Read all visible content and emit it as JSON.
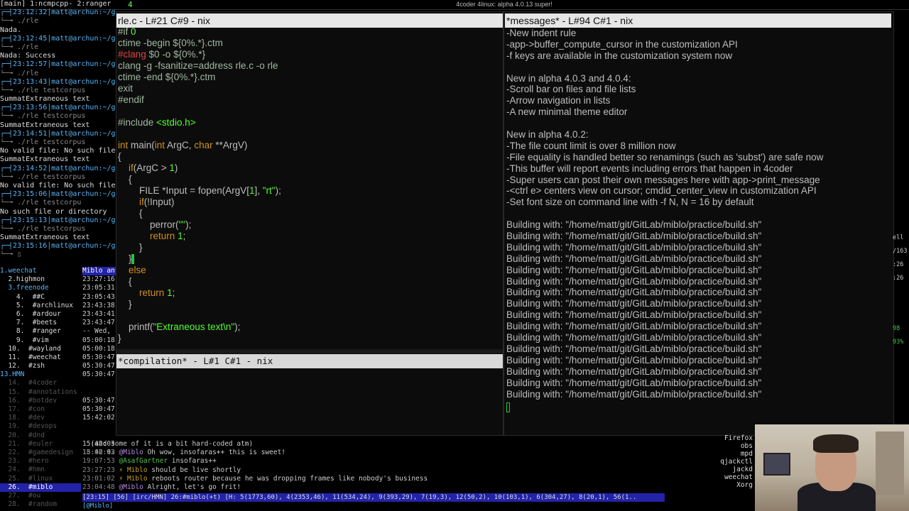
{
  "topbar": {
    "workspace": "4",
    "window_title": "4coder 4linux: alpha 4.0.13 super!"
  },
  "terminal": {
    "lines": [
      {
        "t": "[main] 1:ncmpcpp- 2:ranger",
        "c": "plain"
      },
      {
        "t": "┌─┤23:12:32│matt@archun:~/git",
        "c": "prompt"
      },
      {
        "t": "└─╼ ./rle",
        "c": "cmd"
      },
      {
        "t": "Nada.",
        "c": "plain"
      },
      {
        "t": "┌─┤23:12:45│matt@archun:~/git",
        "c": "prompt"
      },
      {
        "t": "└─╼ ./rle",
        "c": "cmd"
      },
      {
        "t": "Nada: Success",
        "c": "plain"
      },
      {
        "t": "┌─┤23:12:57│matt@archun:~/git",
        "c": "prompt"
      },
      {
        "t": "└─╼ ./rle",
        "c": "cmd"
      },
      {
        "t": "┌─┤23:13:43│matt@archun:~/git",
        "c": "prompt"
      },
      {
        "t": "└─╼ ./rle testcorpus",
        "c": "cmdu"
      },
      {
        "t": "SummatExtraneous text",
        "c": "plain"
      },
      {
        "t": "┌─┤23:13:56│matt@archun:~/git",
        "c": "prompt"
      },
      {
        "t": "└─╼ ./rle testcorpus",
        "c": "cmdu"
      },
      {
        "t": "SummatExtraneous text",
        "c": "plain"
      },
      {
        "t": "┌─┤23:14:51│matt@archun:~/git",
        "c": "prompt"
      },
      {
        "t": "└─╼ ./rle testcorpus",
        "c": "cmdu"
      },
      {
        "t": "No valid file: No such file or",
        "c": "plain"
      },
      {
        "t": "SummatExtraneous text",
        "c": "plain"
      },
      {
        "t": "┌─┤23:14:52│matt@archun:~/git",
        "c": "prompt"
      },
      {
        "t": "└─╼ ./rle testcorpus",
        "c": "cmdu"
      },
      {
        "t": "No valid file: No such file or",
        "c": "plain"
      },
      {
        "t": "┌─┤23:15:06│matt@archun:~/git",
        "c": "prompt"
      },
      {
        "t": "└─╼ ./rle testcorpu",
        "c": "cmdu"
      },
      {
        "t": "No such file or directory",
        "c": "plain"
      },
      {
        "t": "┌─┤23:15:13│matt@archun:~/git",
        "c": "prompt"
      },
      {
        "t": "└─╼ ./rle testcorpus",
        "c": "cmdu"
      },
      {
        "t": "SummatExtraneous text",
        "c": "plain"
      },
      {
        "t": "┌─┤23:15:16│matt@archun:~/git",
        "c": "prompt"
      },
      {
        "t": "└─╼ ▯",
        "c": "cmd"
      }
    ]
  },
  "weechat": {
    "buffers": [
      {
        "t": "1.weechat",
        "c": "#5ab4f5"
      },
      {
        "t": "  2.highmon",
        "c": "#ddd"
      },
      {
        "t": "  3.freenode",
        "c": "#5ab4f5"
      },
      {
        "t": "    4.  ##C",
        "c": "#ddd"
      },
      {
        "t": "    5.  #archlinux",
        "c": "#ddd"
      },
      {
        "t": "    6.  #ardour",
        "c": "#ddd"
      },
      {
        "t": "    7.  #beets",
        "c": "#ddd"
      },
      {
        "t": "    8.  #ranger",
        "c": "#ddd"
      },
      {
        "t": "    9.  #vim",
        "c": "#ddd"
      },
      {
        "t": "  10.  #wayland",
        "c": "#ddd"
      },
      {
        "t": "  11.  #weechat",
        "c": "#ddd"
      },
      {
        "t": "  12.  #zsh",
        "c": "#ddd"
      },
      {
        "t": "13.HMN",
        "c": "#5ab4f5"
      },
      {
        "t": "  14.  #4coder",
        "c": "#555"
      },
      {
        "t": "  15.  #annotations",
        "c": "#555"
      },
      {
        "t": "  16.  #botdev",
        "c": "#555"
      },
      {
        "t": "  17.  #con",
        "c": "#555"
      },
      {
        "t": "  18.  #dev",
        "c": "#555"
      },
      {
        "t": "  19.  #devops",
        "c": "#555"
      },
      {
        "t": "  20.  #dnd",
        "c": "#555"
      },
      {
        "t": "  21.  #euler",
        "c": "#555"
      },
      {
        "t": "  22.  #gamedesign",
        "c": "#555"
      },
      {
        "t": "  23.  #hero",
        "c": "#555"
      },
      {
        "t": "  24.  #hmn",
        "c": "#555"
      },
      {
        "t": "  25.  #linux",
        "c": "#555"
      },
      {
        "t": "  26.  #miblo",
        "c": "#fff",
        "sel": true
      },
      {
        "t": "  27.  #ou",
        "c": "#555"
      },
      {
        "t": "  28.  #random",
        "c": "#555"
      }
    ],
    "channel_tab": "Miblo an",
    "times": [
      "23:27:16",
      "23:05:31",
      "23:05:43",
      "23:43:38",
      "23:43:41",
      "23:43:47",
      "-- Wed,",
      "05:00:18",
      "05:00:18",
      "05:30:47",
      "05:30:47",
      "05:30:47",
      "",
      "",
      "05:30:47",
      "05:30:47",
      "15:42:02",
      "",
      "",
      "15:42:03",
      "15:42:03"
    ],
    "chat": [
      {
        "time": "",
        "nick": "",
        "msg": "(and some of it is a bit hard-coded atm)",
        "nc": "#ccc"
      },
      {
        "time": "18:06:42",
        "nick": "@Miblo",
        "msg": "Oh wow, insofaras++ this is sweet!",
        "nc": "#b68be0"
      },
      {
        "time": "19:07:53",
        "nick": "@AsafGartner",
        "msg": "insofaras++",
        "nc": "#4fc34f"
      },
      {
        "time": "23:27:23",
        "nick": "⚡ Miblo",
        "msg": "should be live shortly",
        "nc": "#c8a020"
      },
      {
        "time": "23:01:02",
        "nick": "⚡ Miblo",
        "msg": "reboots router because he was dropping frames like nobody's business",
        "nc": "#c8a020"
      },
      {
        "time": "23:04:48",
        "nick": "@Miblo",
        "msg": "Alright, let's go frit!",
        "nc": "#b68be0"
      }
    ],
    "status": "[23:15] [56] [irc/HMN] 26:#miblo(+t) [H: 5(1773,60), 4(2353,46), 11(534,24), 9(393,29), 7(19,3), 12(50,2), 10(103,1), 6(304,27), 8(20,1), 56(1..",
    "input": "[@Miblo]"
  },
  "coder": {
    "rle_title": "rle.c - L#21 C#9 - nix",
    "msg_title": "*messages* - L#94 C#1 - nix",
    "comp_title": "*compilation* - L#1 C#1 - nix",
    "code_lines": [
      [
        {
          "t": "#if ",
          "k": "pp"
        },
        {
          "t": "0",
          "k": "num"
        }
      ],
      [
        {
          "t": "ctime -begin ${0%.*}.ctm",
          "k": "pp"
        }
      ],
      [
        {
          "t": "#clang",
          "k": "cmt"
        },
        {
          "t": " $0 -o ${0%.*}",
          "k": "pp"
        }
      ],
      [
        {
          "t": "clang -g -fsanitize=address rle.c -o rle",
          "k": "pp"
        }
      ],
      [
        {
          "t": "ctime -end ${0%.*}.ctm",
          "k": "pp"
        }
      ],
      [
        {
          "t": "exit",
          "k": "pp"
        }
      ],
      [
        {
          "t": "#endif",
          "k": "pp"
        }
      ],
      [
        {
          "t": "",
          "k": "n"
        }
      ],
      [
        {
          "t": "#include ",
          "k": "pp"
        },
        {
          "t": "<stdio.h>",
          "k": "str"
        }
      ],
      [
        {
          "t": "",
          "k": "n"
        }
      ],
      [
        {
          "t": "int",
          "k": "kw"
        },
        {
          "t": " main(",
          "k": "n"
        },
        {
          "t": "int",
          "k": "kw"
        },
        {
          "t": " ArgC, ",
          "k": "n"
        },
        {
          "t": "char",
          "k": "kw"
        },
        {
          "t": " **ArgV)",
          "k": "n"
        }
      ],
      [
        {
          "t": "{",
          "k": "n"
        }
      ],
      [
        {
          "t": "    ",
          "k": "n"
        },
        {
          "t": "if",
          "k": "kw"
        },
        {
          "t": "(ArgC > ",
          "k": "n"
        },
        {
          "t": "1",
          "k": "num"
        },
        {
          "t": ")",
          "k": "n"
        }
      ],
      [
        {
          "t": "    {",
          "k": "n"
        }
      ],
      [
        {
          "t": "        FILE *Input = fopen(ArgV[",
          "k": "n"
        },
        {
          "t": "1",
          "k": "num"
        },
        {
          "t": "], ",
          "k": "n"
        },
        {
          "t": "\"rt\"",
          "k": "str"
        },
        {
          "t": ");",
          "k": "n"
        }
      ],
      [
        {
          "t": "        ",
          "k": "n"
        },
        {
          "t": "if",
          "k": "kw"
        },
        {
          "t": "(!Input)",
          "k": "n"
        }
      ],
      [
        {
          "t": "        {",
          "k": "n"
        }
      ],
      [
        {
          "t": "            perror(",
          "k": "n"
        },
        {
          "t": "\"\"",
          "k": "str"
        },
        {
          "t": ");",
          "k": "n"
        }
      ],
      [
        {
          "t": "            ",
          "k": "n"
        },
        {
          "t": "return",
          "k": "kw"
        },
        {
          "t": " ",
          "k": "n"
        },
        {
          "t": "1",
          "k": "num"
        },
        {
          "t": ";",
          "k": "n"
        }
      ],
      [
        {
          "t": "        }",
          "k": "n"
        }
      ],
      [
        {
          "t": "    }",
          "k": "n"
        }
      ],
      [
        {
          "t": "    ",
          "k": "n"
        },
        {
          "t": "else",
          "k": "kw"
        }
      ],
      [
        {
          "t": "    {",
          "k": "n"
        }
      ],
      [
        {
          "t": "        ",
          "k": "n"
        },
        {
          "t": "return",
          "k": "kw"
        },
        {
          "t": " ",
          "k": "n"
        },
        {
          "t": "1",
          "k": "num"
        },
        {
          "t": ";",
          "k": "n"
        }
      ],
      [
        {
          "t": "    }",
          "k": "n"
        }
      ],
      [
        {
          "t": "",
          "k": "n"
        }
      ],
      [
        {
          "t": "    printf(",
          "k": "n"
        },
        {
          "t": "\"Extraneous text\\n\"",
          "k": "str"
        },
        {
          "t": ");",
          "k": "n"
        }
      ],
      [
        {
          "t": "}",
          "k": "n"
        }
      ]
    ],
    "messages": [
      "-New indent rule",
      "-app->buffer_compute_cursor in the customization API",
      "-f keys are available in the customization system now",
      "",
      "New in alpha 4.0.3 and 4.0.4:",
      "-Scroll bar on files and file lists",
      "-Arrow navigation in lists",
      "-A new minimal theme editor",
      "",
      "New in alpha 4.0.2:",
      "-The file count limit is over 8 million now",
      "-File equality is handled better so renamings (such as 'subst') are safe now",
      "-This buffer will report events including errors that happen in 4coder",
      "-Super users can post their own messages here with app->print_message",
      "-<ctrl e> centers view on cursor; cmdid_center_view in customization API",
      "-Set font size on command line with -f N, N = 16 by default",
      "",
      "Building with: \"/home/matt/git/GitLab/miblo/practice/build.sh\"",
      "Building with: \"/home/matt/git/GitLab/miblo/practice/build.sh\"",
      "Building with: \"/home/matt/git/GitLab/miblo/practice/build.sh\"",
      "Building with: \"/home/matt/git/GitLab/miblo/practice/build.sh\"",
      "Building with: \"/home/matt/git/GitLab/miblo/practice/build.sh\"",
      "Building with: \"/home/matt/git/GitLab/miblo/practice/build.sh\"",
      "Building with: \"/home/matt/git/GitLab/miblo/practice/build.sh\"",
      "Building with: \"/home/matt/git/GitLab/miblo/practice/build.sh\"",
      "Building with: \"/home/matt/git/GitLab/miblo/practice/build.sh\"",
      "Building with: \"/home/matt/git/GitLab/miblo/practice/build.sh\"",
      "Building with: \"/home/matt/git/GitLab/miblo/practice/build.sh\"",
      "Building with: \"/home/matt/git/GitLab/miblo/practice/build.sh\"",
      "Building with: \"/home/matt/git/GitLab/miblo/practice/build.sh\"",
      "Building with: \"/home/matt/git/GitLab/miblo/practice/build.sh\"",
      "Building with: \"/home/matt/git/GitLab/miblo/practice/build.sh\"",
      "Building with: \"/home/matt/git/GitLab/miblo/practice/build.sh\""
    ]
  },
  "right_side": {
    "labels": [
      "ell",
      "/163",
      ":26",
      ":26",
      "98",
      "93%"
    ]
  },
  "processes": [
    "Firefox",
    "obs",
    "mpd",
    "qjackctl",
    "jackd",
    "weechat",
    "Xorg"
  ],
  "colors": {
    "accent_green": "#19c93b",
    "keyword": "#d08f20",
    "string": "#50ff30",
    "status_bar": "#2323a8"
  }
}
